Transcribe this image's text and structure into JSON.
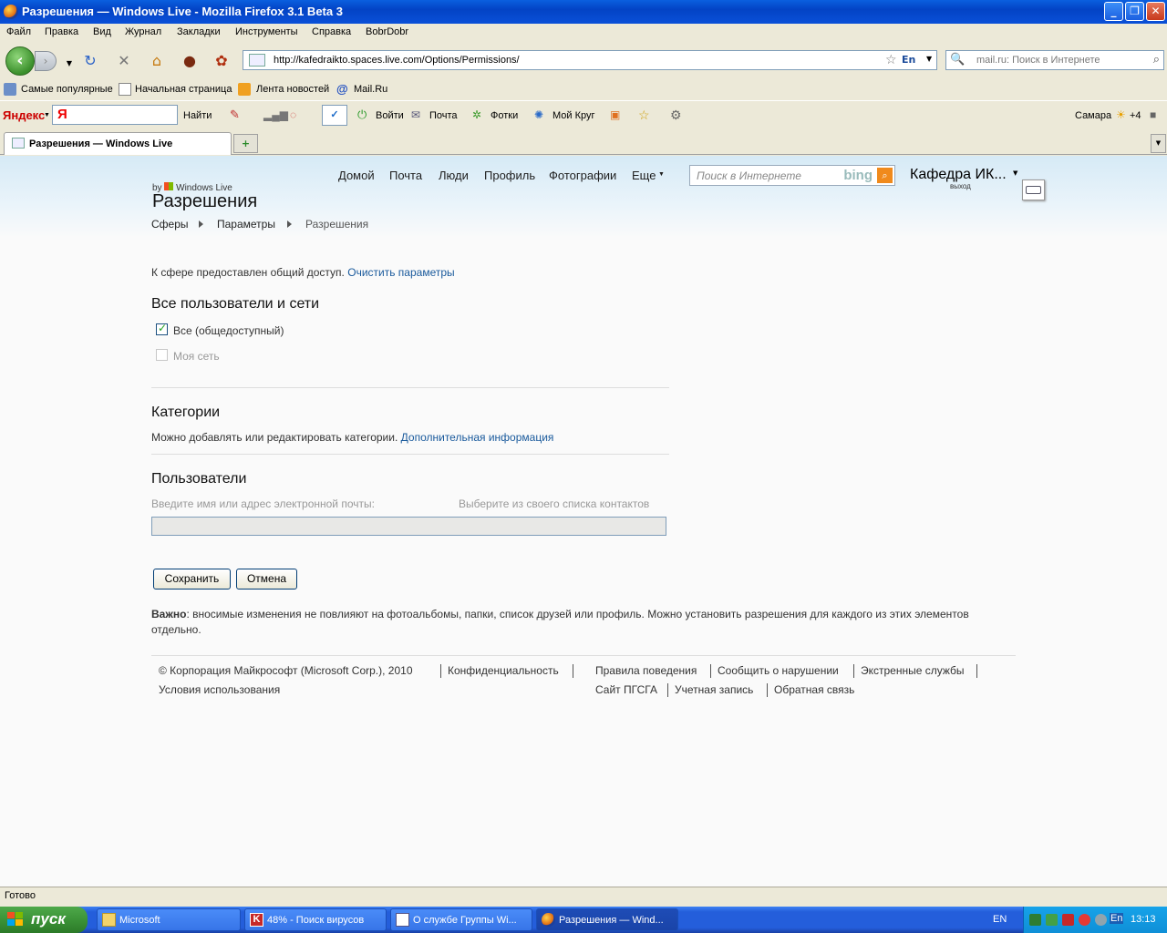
{
  "window": {
    "title": "Разрешения — Windows Live - Mozilla Firefox 3.1 Beta 3",
    "minimize_icon": "_",
    "maximize_icon": "❐",
    "close_icon": "✕"
  },
  "menu": [
    "Файл",
    "Правка",
    "Вид",
    "Журнал",
    "Закладки",
    "Инструменты",
    "Справка",
    "BobrDobr"
  ],
  "navbar": {
    "url": "http://kafedraikto.spaces.live.com/Options/Permissions/",
    "lang_badge": "En",
    "search_placeholder": "mail.ru: Поиск в Интернете"
  },
  "bookmarks": [
    "Самые популярные",
    "Начальная страница",
    "Лента новостей",
    "Mail.Ru"
  ],
  "yandex_bar": {
    "logo": "Яндекс",
    "find": "Найти",
    "login": "Войти",
    "mail": "Почта",
    "photos": "Фотки",
    "circle": "Мой Круг",
    "city": "Самара",
    "temp": "+4"
  },
  "tabs": [
    {
      "label": "Разрешения — Windows Live",
      "active": true
    }
  ],
  "site": {
    "nav": [
      "Домой",
      "Почта",
      "Люди",
      "Профиль",
      "Фотографии",
      "Еще"
    ],
    "search_placeholder": "Поиск в Интернете",
    "search_brand": "bing",
    "user_name": "Кафедра ИК...",
    "logout": "выход",
    "by_label": "by",
    "brand": "Windows Live",
    "page_title": "Разрешения",
    "breadcrumb": [
      "Сферы",
      "Параметры",
      "Разрешения"
    ]
  },
  "content": {
    "shared_text": "К сфере предоставлен общий доступ.",
    "clear_link": "Очистить параметры",
    "section_all": "Все пользователи и сети",
    "cb_everyone": {
      "label": "Все (общедоступный)",
      "checked": true
    },
    "cb_network": {
      "label": "Моя сеть",
      "checked": false,
      "disabled": true
    },
    "section_categories": "Категории",
    "categories_text": "Можно добавлять или редактировать категории.",
    "categories_link": "Дополнительная информация",
    "section_users": "Пользователи",
    "users_prompt": "Введите имя или адрес электронной почты:",
    "users_contacts": "Выберите из своего списка контактов",
    "save": "Сохранить",
    "cancel": "Отмена",
    "important_label": "Важно",
    "important_text": ": вносимые изменения не повлияют на фотоальбомы, папки, список друзей или профиль. Можно установить разрешения для каждого из этих элементов отдельно."
  },
  "footer": {
    "copyright": "© Корпорация Майкрософт (Microsoft Corp.), 2010",
    "privacy": "Конфиденциальность",
    "terms": "Условия использования",
    "links_row1": [
      "Правила поведения",
      "Сообщить о нарушении",
      "Экстренные службы"
    ],
    "links_row2": [
      "Сайт ПГСГА",
      "Учетная запись",
      "Обратная связь"
    ]
  },
  "status": "Готово",
  "taskbar": {
    "start": "пуск",
    "tasks": [
      {
        "label": "Microsoft",
        "icon": "folder-icon"
      },
      {
        "label": "48% - Поиск вирусов",
        "icon": "antivirus-icon"
      },
      {
        "label": "О службе Группы Wi...",
        "icon": "document-icon"
      },
      {
        "label": "Разрешения — Wind...",
        "icon": "firefox-icon",
        "active": true
      }
    ],
    "lang": "EN",
    "tray_lang": "En",
    "clock": "13:13"
  }
}
